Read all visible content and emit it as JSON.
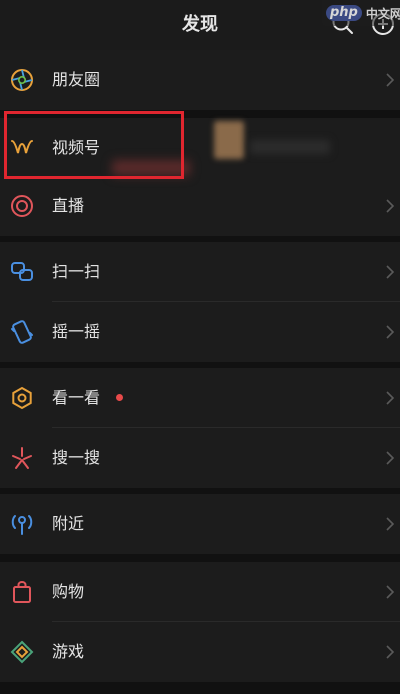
{
  "header": {
    "title": "发现",
    "search_icon": "search-icon",
    "add_icon": "plus-circle-icon"
  },
  "watermark": {
    "php": "php",
    "cn": "中文网"
  },
  "menu": {
    "moments": {
      "label": "朋友圈",
      "icon": "moments-aperture-icon"
    },
    "channels": {
      "label": "视频号",
      "icon": "channels-icon"
    },
    "live": {
      "label": "直播",
      "icon": "live-icon"
    },
    "scan": {
      "label": "扫一扫",
      "icon": "scan-icon"
    },
    "shake": {
      "label": "摇一摇",
      "icon": "shake-icon"
    },
    "top_stories": {
      "label": "看一看",
      "icon": "top-stories-icon"
    },
    "search": {
      "label": "搜一搜",
      "icon": "search-spark-icon"
    },
    "nearby": {
      "label": "附近",
      "icon": "nearby-icon"
    },
    "shopping": {
      "label": "购物",
      "icon": "shopping-bag-icon"
    },
    "games": {
      "label": "游戏",
      "icon": "games-icon"
    }
  },
  "colors": {
    "background": "#111111",
    "row": "#1c1c1c",
    "header": "#1b1b1b",
    "text": "#e4e4e4",
    "highlight": "#e0262f",
    "badge": "#e84a4a",
    "chevron": "#5a5a5a"
  }
}
